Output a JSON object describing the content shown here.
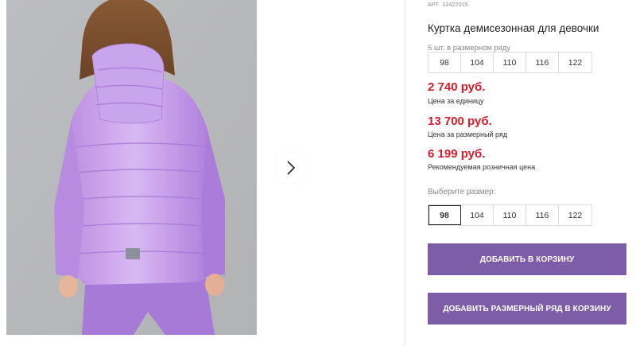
{
  "gallery": {
    "next_icon": "chevron-right-icon"
  },
  "product": {
    "sku_label": "АРТ.",
    "sku_value": "12422015",
    "title": "Куртка демисезонная для девочки",
    "row_note": "5 шт. в размерном ряду",
    "row_sizes": [
      "98",
      "104",
      "110",
      "116",
      "122"
    ],
    "unit_price": "2 740 руб.",
    "unit_price_label": "Цена за единицу",
    "row_price": "13 700 руб.",
    "row_price_label": "Цена за размерный ряд",
    "retail_price": "6 199 руб.",
    "retail_price_label": "Рекомендуемая розничная цена",
    "choose_size_label": "Выберите размер:",
    "size_options": [
      "98",
      "104",
      "110",
      "116",
      "122"
    ],
    "selected_size": "98"
  },
  "actions": {
    "add_to_cart": "ДОБАВИТЬ В КОРЗИНУ",
    "add_row_to_cart": "ДОБАВИТЬ РАЗМЕРНЫЙ РЯД В КОРЗИНУ"
  },
  "colors": {
    "price": "#d81a2a",
    "button": "#7d5ca8",
    "jacket": "#c39ae6",
    "pants": "#a77ad8"
  }
}
